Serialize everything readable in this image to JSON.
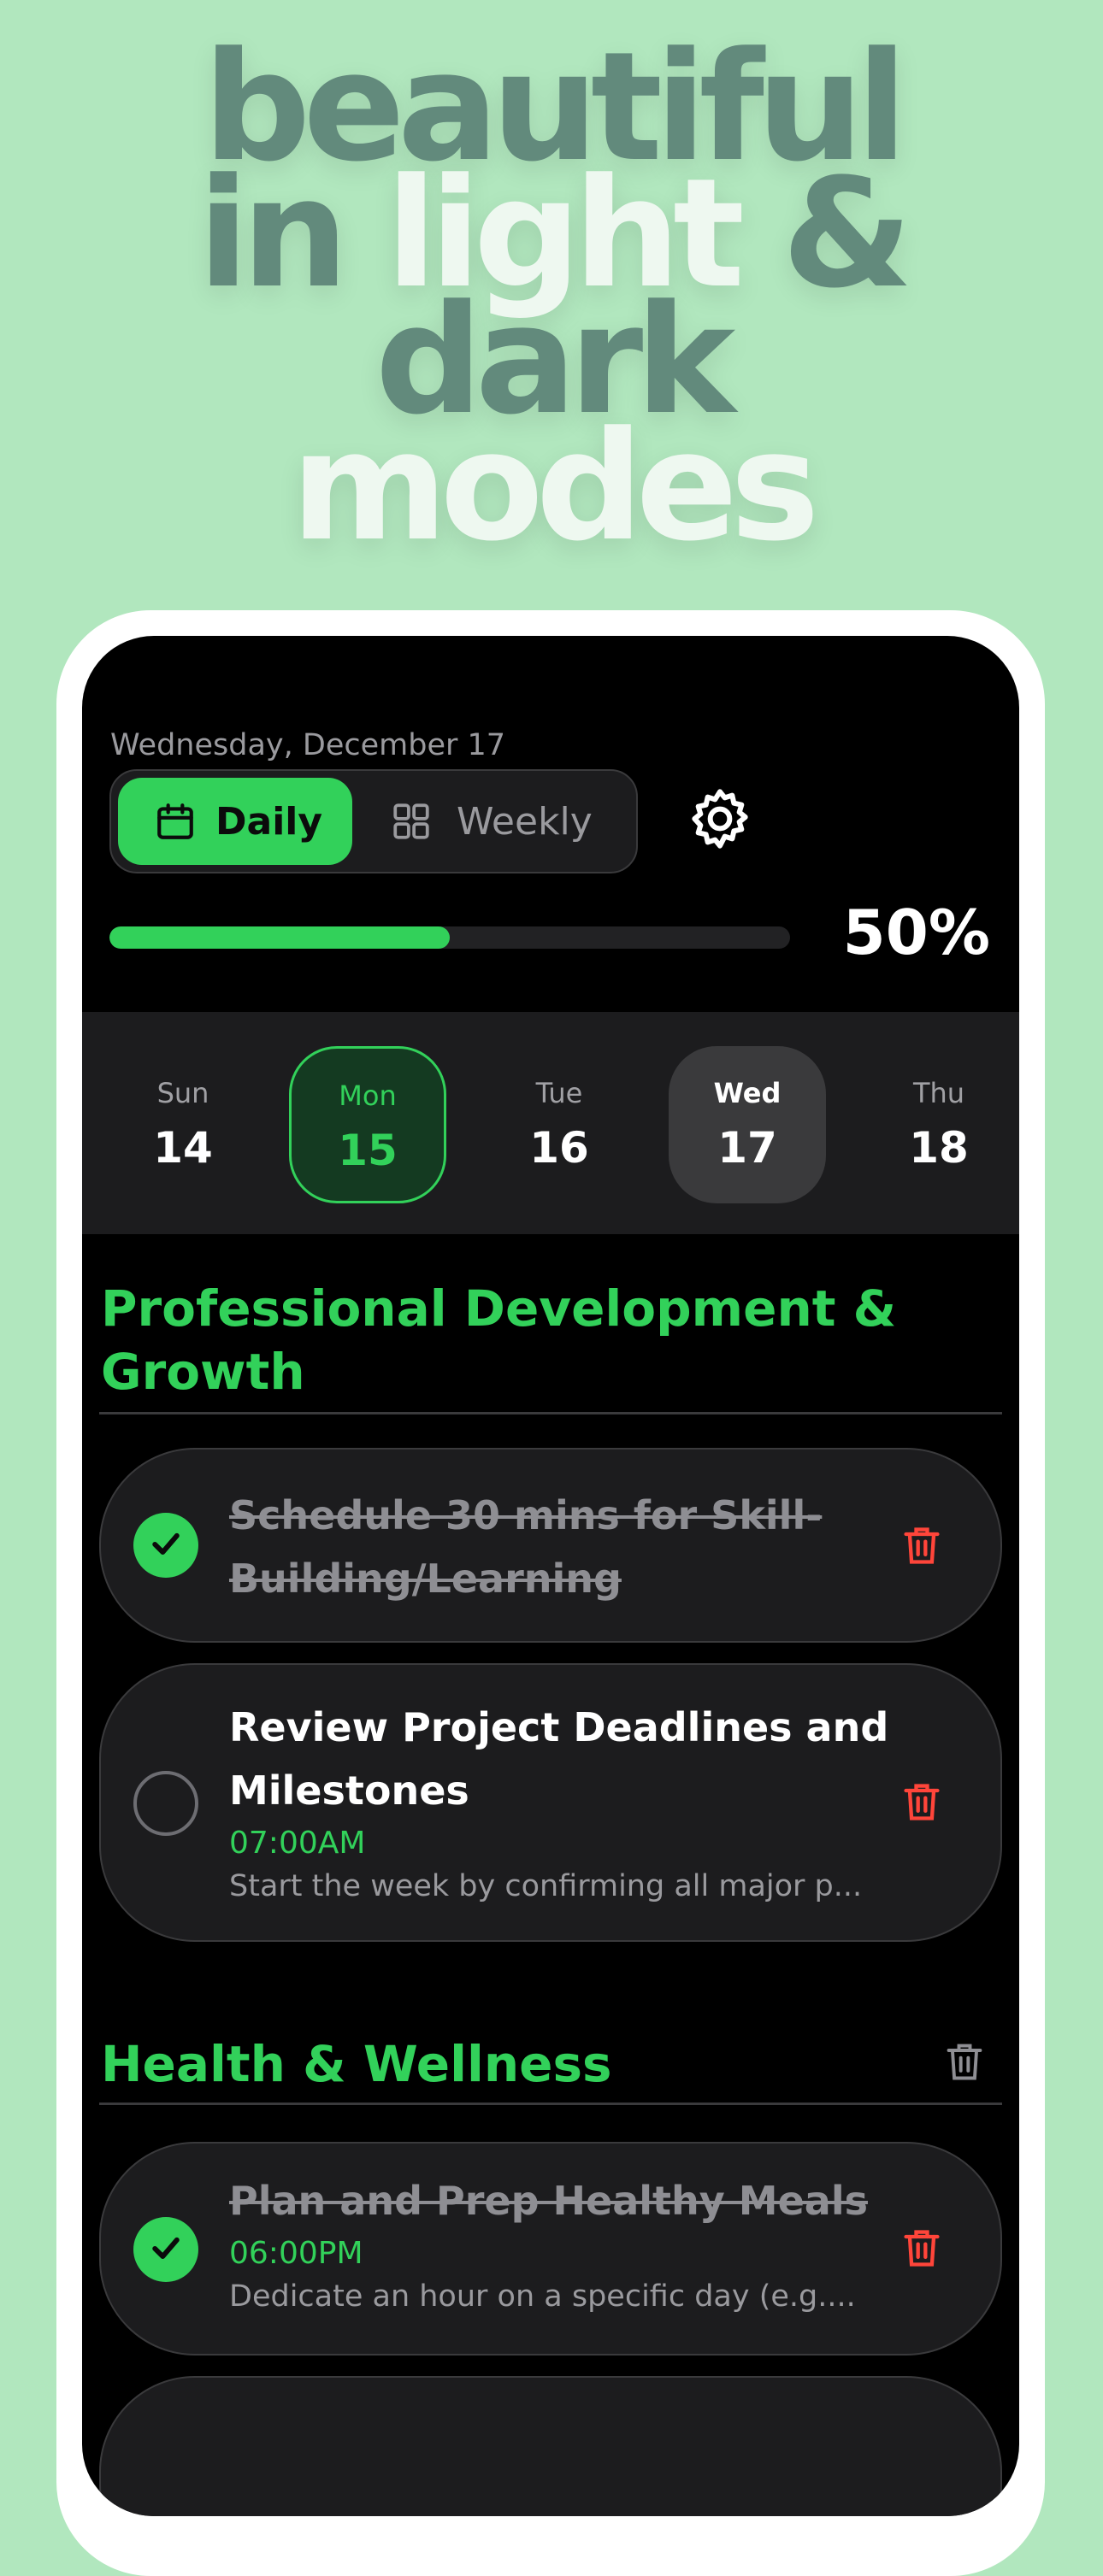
{
  "headline": {
    "line1": "beautiful",
    "line2_part1": "in ",
    "line2_part2": "light",
    "line2_part3": " &",
    "line3": "dark",
    "line4": "modes"
  },
  "app": {
    "date_label": "Wednesday, December 17",
    "view_toggle": {
      "daily_label": "Daily",
      "weekly_label": "Weekly",
      "selected": "Daily"
    },
    "settings_icon": "gear-icon",
    "progress": {
      "value": 0.5,
      "label": "50%"
    },
    "days": [
      {
        "name": "Sun",
        "date": "14",
        "state": "normal"
      },
      {
        "name": "Mon",
        "date": "15",
        "state": "today"
      },
      {
        "name": "Tue",
        "date": "16",
        "state": "normal"
      },
      {
        "name": "Wed",
        "date": "17",
        "state": "selected"
      },
      {
        "name": "Thu",
        "date": "18",
        "state": "normal"
      }
    ],
    "sections": [
      {
        "title": "Professional Development & Growth",
        "tasks": [
          {
            "title": "Schedule 30 mins for Skill-Building/Learning",
            "done": true
          },
          {
            "title": "Review Project Deadlines and Milestones",
            "done": false,
            "time": "07:00AM",
            "description": "Start the week by confirming all major p..."
          }
        ]
      },
      {
        "title": "Health & Wellness",
        "tasks": [
          {
            "title": "Plan and Prep Healthy Meals",
            "done": true,
            "time": "06:00PM",
            "description": "Dedicate an hour on a specific day (e.g...."
          }
        ]
      }
    ]
  },
  "colors": {
    "background": "#b1e7be",
    "accent": "#32d15a",
    "delete": "#ff453a",
    "headline_muted": "#628a7c",
    "headline_light": "#eef8f0"
  }
}
